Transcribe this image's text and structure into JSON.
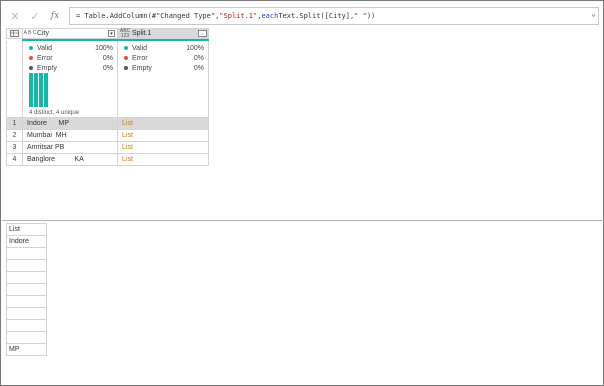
{
  "formula_bar": {
    "cancel_icon": "close-icon",
    "confirm_icon": "check-icon",
    "fx_label": "fx",
    "formula_prefix": "= Table.AddColumn(#\"Changed Type\", ",
    "formula_string1": "\"Split.1\"",
    "formula_mid": ", ",
    "formula_keyword": "each",
    "formula_rest": " Text.Split([City],",
    "formula_string2": "\" \"",
    "formula_end": "))",
    "expand_icon": "chevron-down-icon"
  },
  "columns": [
    {
      "name": "City",
      "type_icon": "A B C",
      "stats": [
        {
          "label": "Valid",
          "pct": "100%",
          "color": "#14b8a6"
        },
        {
          "label": "Error",
          "pct": "0%",
          "color": "#e74c3c"
        },
        {
          "label": "Empty",
          "pct": "0%",
          "color": "#555555"
        }
      ],
      "distribution": [
        1,
        1,
        1,
        1
      ],
      "distinct_label": "4 distinct, 4 unique"
    },
    {
      "name": "Split.1",
      "type_icon": "ABC 123",
      "stats": [
        {
          "label": "Valid",
          "pct": "100%",
          "color": "#14b8a6"
        },
        {
          "label": "Error",
          "pct": "0%",
          "color": "#e74c3c"
        },
        {
          "label": "Empty",
          "pct": "0%",
          "color": "#555555"
        }
      ]
    }
  ],
  "rows": [
    {
      "num": "1",
      "city": "Indore      MP",
      "split": "List"
    },
    {
      "num": "2",
      "city": "Mumbai  MH",
      "split": "List"
    },
    {
      "num": "3",
      "city": "Amritsar PB",
      "split": "List"
    },
    {
      "num": "4",
      "city": "Banglore          KA",
      "split": "List"
    }
  ],
  "preview": {
    "header": "List",
    "items": [
      "Indore",
      "",
      "",
      "",
      "",
      "",
      "",
      "",
      "",
      "MP"
    ]
  },
  "colors": {
    "accent": "#14b8a6",
    "list_link": "#c07a14",
    "selected_row": "#d9d9d9"
  }
}
